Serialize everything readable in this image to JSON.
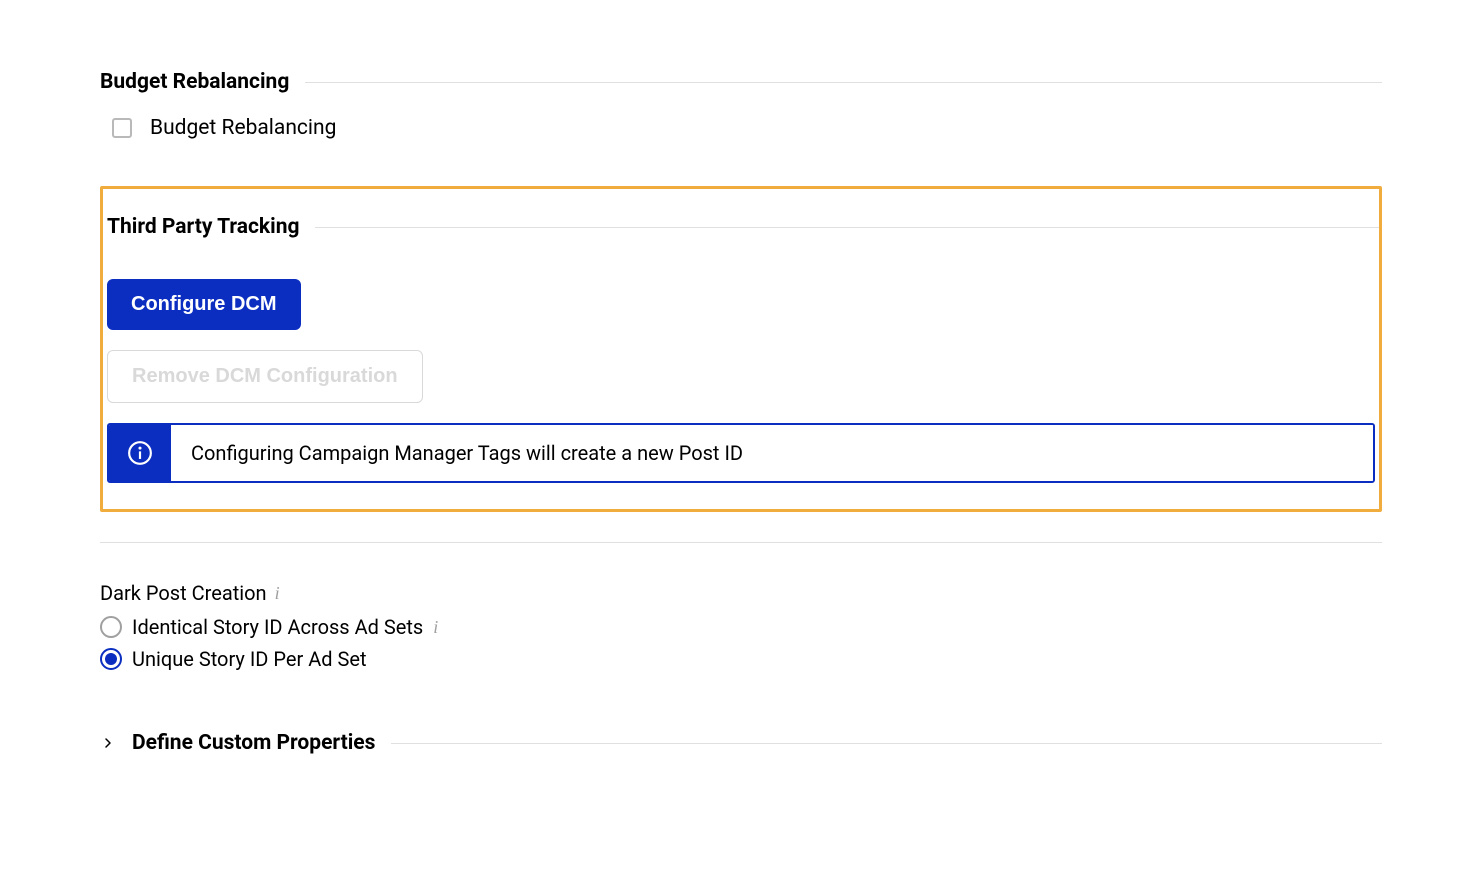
{
  "sections": {
    "budget": {
      "title": "Budget Rebalancing",
      "checkbox_label": "Budget Rebalancing"
    },
    "tracking": {
      "title": "Third Party Tracking",
      "configure_btn": "Configure DCM",
      "remove_btn": "Remove DCM Configuration",
      "info_text": "Configuring Campaign Manager Tags will create a new Post ID"
    },
    "dark_post": {
      "label": "Dark Post Creation",
      "options": {
        "identical": "Identical Story ID Across Ad Sets",
        "unique": "Unique Story ID Per Ad Set"
      }
    },
    "custom_props": {
      "title": "Define Custom Properties"
    }
  }
}
